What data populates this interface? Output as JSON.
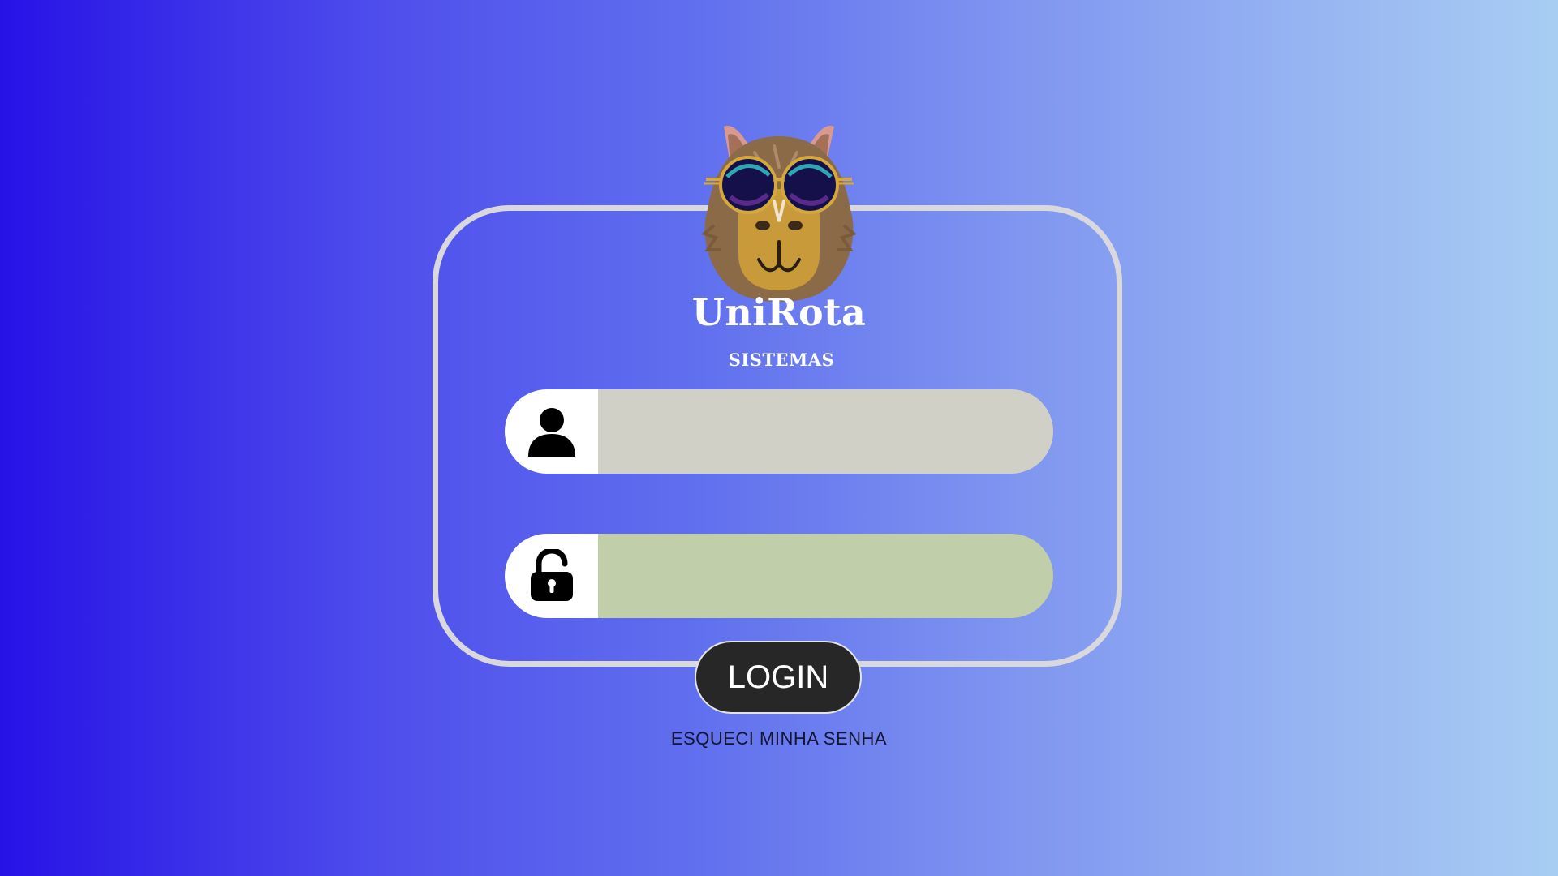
{
  "brand": {
    "title": "UniRota",
    "subtitle": "SISTEMAS",
    "mascot": "capybara-with-sunglasses"
  },
  "form": {
    "username": {
      "value": "",
      "placeholder": "",
      "icon": "user-icon",
      "background": "#d1d0c6"
    },
    "password": {
      "value": "",
      "placeholder": "",
      "icon": "lock-open-icon",
      "background": "#c0cfaa"
    },
    "login_label": "LOGIN",
    "forgot_label": "ESQUECI MINHA SENHA"
  },
  "colors": {
    "gradient_start": "#2712e6",
    "gradient_end": "#a8cdf3",
    "card_border": "#d9d8dc",
    "button_bg": "#272727"
  }
}
